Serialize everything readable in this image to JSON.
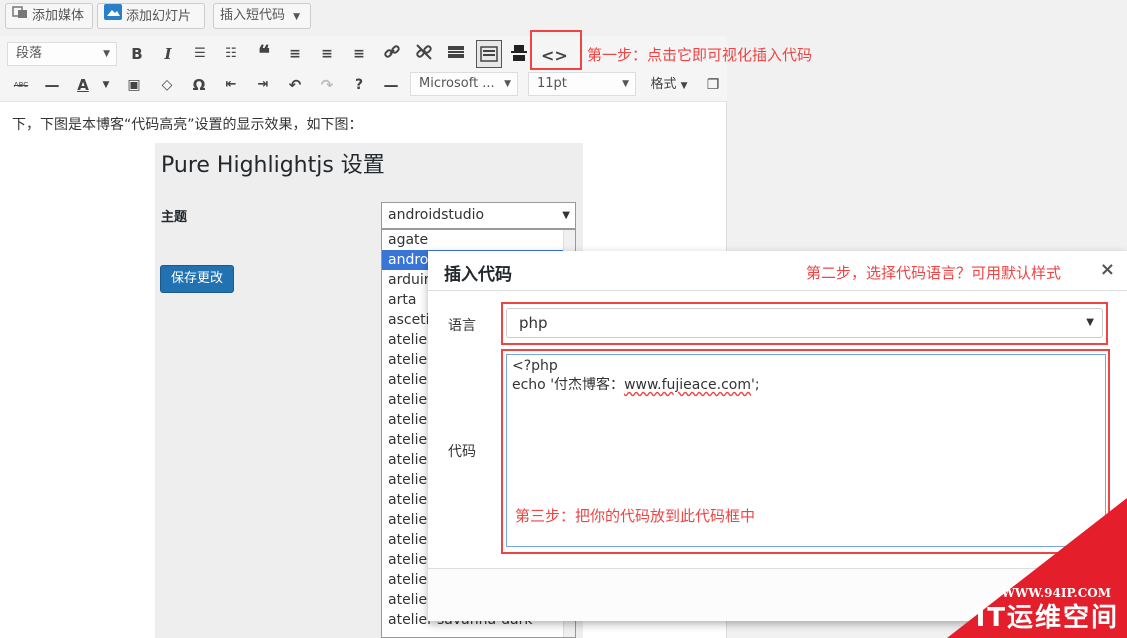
{
  "topbar": {
    "add_media": "添加媒体",
    "add_slides": "添加幻灯片",
    "insert_shortcode": "插入短代码"
  },
  "toolbar": {
    "format_select": "段落",
    "font_select": "Microsoft ...",
    "size_select": "11pt",
    "styles_label": "格式",
    "abc_label": "ABC",
    "code_button": "<>"
  },
  "annotations": {
    "step1": "第一步：点击它即可视化插入代码",
    "step2": "第二步，选择代码语言？可用默认样式",
    "step3": "第三步：把你的代码放到此代码框中"
  },
  "post": {
    "intro": "下，下图是本博客“代码高亮”设置的显示效果，如下图："
  },
  "settings": {
    "title": "Pure Highlightjs 设置",
    "theme_label": "主题",
    "theme_value": "androidstudio",
    "save_button": "保存更改",
    "theme_options": [
      "agate",
      "andro",
      "arduir",
      "arta",
      "ascetic",
      "atelier",
      "atelier",
      "atelier",
      "atelier",
      "atelier",
      "atelier",
      "atelier",
      "atelier",
      "atelier",
      "atelier",
      "atelier",
      "atelier",
      "atelier",
      "atelier",
      "atelier-savanna-dark"
    ]
  },
  "modal": {
    "title": "插入代码",
    "close": "×",
    "language_label": "语言",
    "language_value": "php",
    "code_label": "代码",
    "code_line1": "<?php",
    "code_line2_pre": "echo '付杰博客：",
    "code_line2_link": "www.fujieace.com",
    "code_line2_post": "';"
  },
  "watermark": {
    "url": "WWW.94IP.COM",
    "name": "IT运维空间"
  }
}
